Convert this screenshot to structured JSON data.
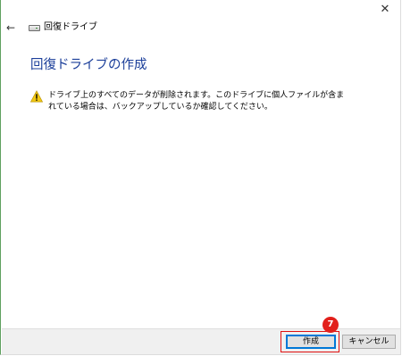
{
  "window": {
    "close_glyph": "✕",
    "back_glyph": "←",
    "app_title": "回復ドライブ"
  },
  "main": {
    "page_title": "回復ドライブの作成",
    "warning_text": "ドライブ上のすべてのデータが削除されます。このドライブに個人ファイルが含まれている場合は、バックアップしているか確認してください。"
  },
  "footer": {
    "create_label": "作成",
    "cancel_label": "キャンセル"
  },
  "annotation": {
    "step_number": "7",
    "highlight_color": "#e01010",
    "badge_color": "#e2201b"
  },
  "icons": {
    "drive": "drive-icon",
    "warning": "warning-icon",
    "back": "back-arrow-icon",
    "close": "close-icon"
  },
  "colors": {
    "title_blue": "#1c3f9a",
    "footer_bg": "#f0f0f0",
    "default_button_border": "#0078d7"
  }
}
